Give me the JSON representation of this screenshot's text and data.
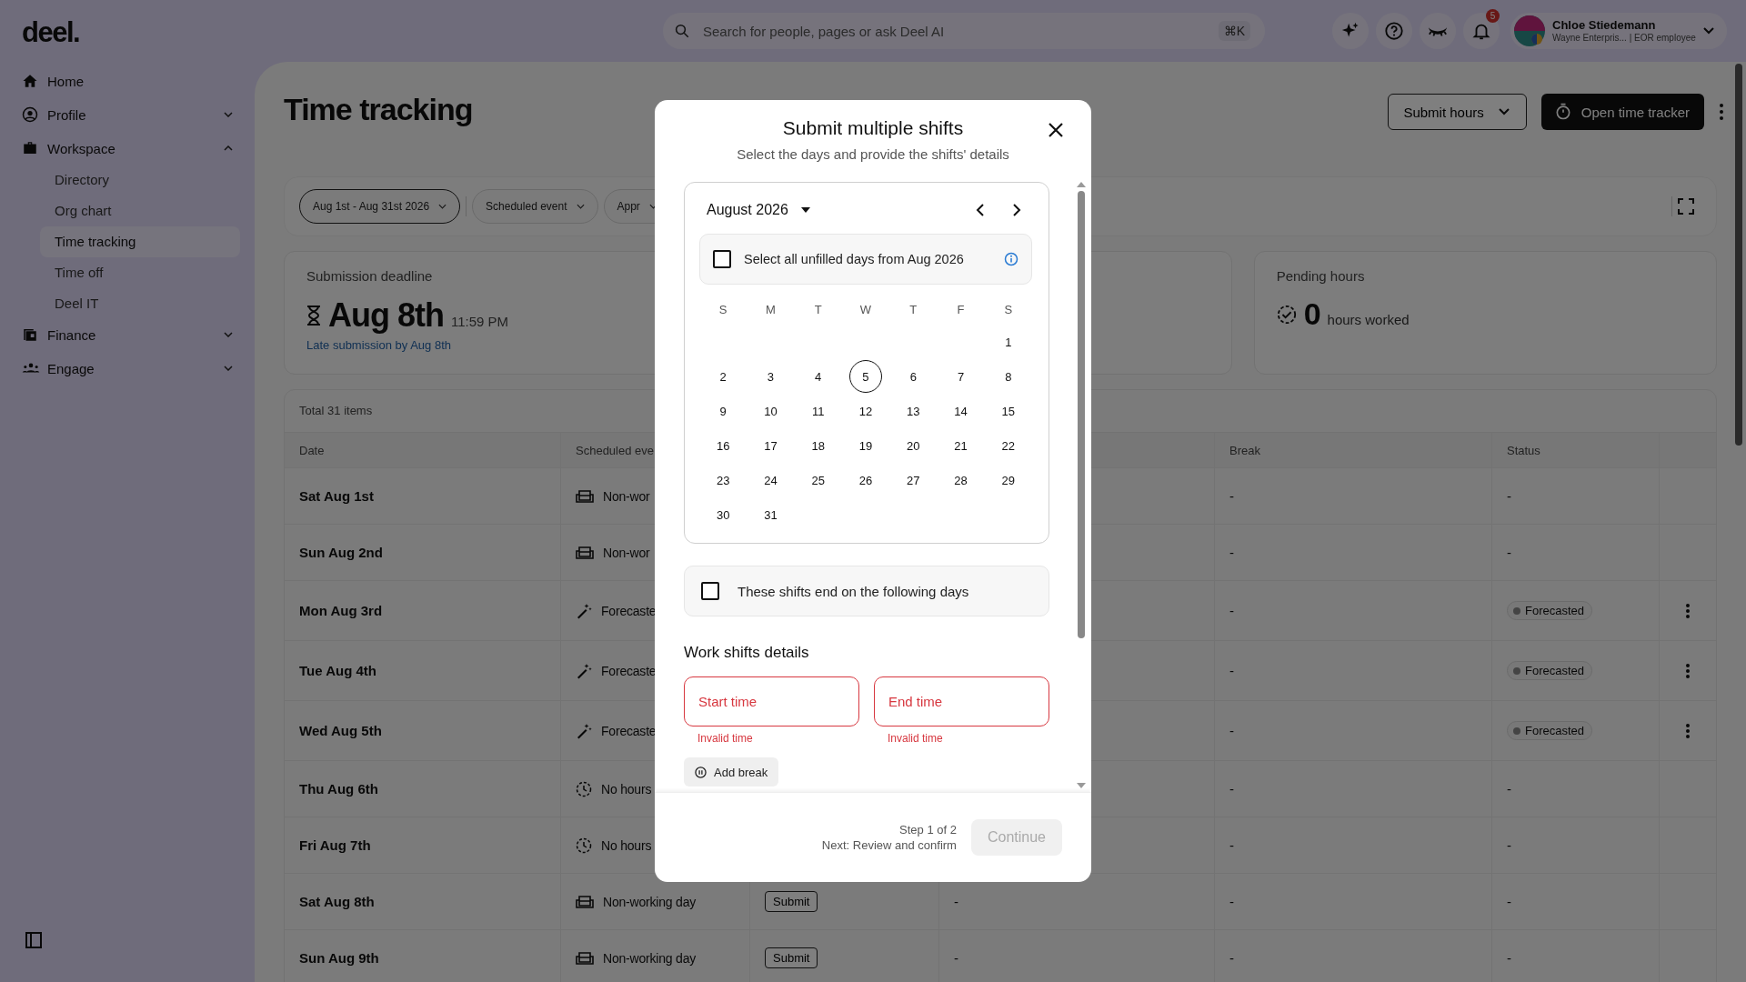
{
  "logo": "deel.",
  "search": {
    "placeholder": "Search for people, pages or ask Deel AI",
    "shortcut": "⌘K"
  },
  "notifications": {
    "count": "5"
  },
  "profile": {
    "name": "Chloe Stiedemann",
    "subtitle": "Wayne Enterpris... | EOR employee"
  },
  "sidebar": {
    "items": [
      {
        "label": "Home"
      },
      {
        "label": "Profile",
        "expanded": false
      },
      {
        "label": "Workspace",
        "expanded": true,
        "children": [
          {
            "label": "Directory",
            "selected": false
          },
          {
            "label": "Org chart",
            "selected": false
          },
          {
            "label": "Time tracking",
            "selected": true
          },
          {
            "label": "Time off",
            "selected": false
          },
          {
            "label": "Deel IT",
            "selected": false
          }
        ]
      },
      {
        "label": "Finance",
        "expanded": false
      },
      {
        "label": "Engage",
        "expanded": false
      }
    ]
  },
  "page": {
    "title": "Time tracking",
    "submit_button": "Submit hours",
    "tracker_button": "Open time tracker"
  },
  "filters": [
    {
      "label": "Aug 1st - Aug 31st 2026",
      "selected": true
    },
    {
      "label": "Scheduled event",
      "selected": false
    },
    {
      "label": "Appr",
      "selected": false
    }
  ],
  "deadline_card": {
    "title": "Submission deadline",
    "date": "Aug 8th",
    "time": "11:59 PM",
    "link": "Late submission by Aug 8th"
  },
  "pending_card": {
    "title": "Pending hours",
    "value": "0",
    "unit": "hours worked"
  },
  "table": {
    "total": "Total 31 items",
    "columns": [
      "Date",
      "Scheduled eve",
      "Break",
      "Status"
    ],
    "rows": [
      {
        "date": "Sat Aug 1st",
        "event": {
          "kind": "non_working",
          "text": "Non-wor"
        },
        "break": "-",
        "status": {
          "kind": "plain",
          "text": "-"
        },
        "menu": false
      },
      {
        "date": "Sun Aug 2nd",
        "event": {
          "kind": "non_working",
          "text": "Non-wor"
        },
        "break": "-",
        "status": {
          "kind": "plain",
          "text": "-"
        },
        "menu": false
      },
      {
        "date": "Mon Aug 3rd",
        "event": {
          "kind": "forecast",
          "text": "Forecaste"
        },
        "break": "-",
        "status": {
          "kind": "badge",
          "text": "Forecasted"
        },
        "menu": true
      },
      {
        "date": "Tue Aug 4th",
        "event": {
          "kind": "forecast",
          "text": "Forecaste"
        },
        "break": "-",
        "status": {
          "kind": "badge",
          "text": "Forecasted"
        },
        "menu": true
      },
      {
        "date": "Wed Aug 5th",
        "event": {
          "kind": "forecast",
          "text": "Forecaste"
        },
        "break": "-",
        "status": {
          "kind": "badge",
          "text": "Forecasted"
        },
        "menu": true
      },
      {
        "date": "Thu Aug 6th",
        "event": {
          "kind": "no_hours",
          "text": "No hours"
        },
        "break": "-",
        "status": {
          "kind": "plain",
          "text": "-"
        },
        "menu": false
      },
      {
        "date": "Fri Aug 7th",
        "event": {
          "kind": "no_hours",
          "text": "No hours"
        },
        "break": "-",
        "status": {
          "kind": "plain",
          "text": "-"
        },
        "menu": false
      },
      {
        "date": "Sat Aug 8th",
        "event": {
          "kind": "non_working",
          "text": "Non-working day"
        },
        "action": "Submit",
        "column_4": "-",
        "break": "-",
        "status": {
          "kind": "plain",
          "text": "-"
        },
        "menu": false
      },
      {
        "date": "Sun Aug 9th",
        "event": {
          "kind": "non_working",
          "text": "Non-working day"
        },
        "action": "Submit",
        "column_4": "-",
        "break": "-",
        "status": {
          "kind": "plain",
          "text": "-"
        },
        "menu": false
      }
    ]
  },
  "dialog": {
    "title": "Submit multiple shifts",
    "subtitle": "Select the days and provide the shifts' details",
    "calendar": {
      "month": "August 2026",
      "select_all": {
        "label": "Select all unfilled days from Aug 2026",
        "checked": false
      },
      "weekdays": [
        "S",
        "M",
        "T",
        "W",
        "T",
        "F",
        "S"
      ],
      "weeks": [
        [
          {
            "day": "1",
            "today": false
          }
        ],
        [
          {
            "day": "2",
            "today": false
          },
          {
            "day": "3",
            "today": false
          },
          {
            "day": "4",
            "today": false
          },
          {
            "day": "5",
            "today": true
          },
          {
            "day": "6",
            "today": false
          },
          {
            "day": "7",
            "today": false
          },
          {
            "day": "8",
            "today": false
          }
        ],
        [
          {
            "day": "9",
            "today": false
          },
          {
            "day": "10",
            "today": false
          },
          {
            "day": "11",
            "today": false
          },
          {
            "day": "12",
            "today": false
          },
          {
            "day": "13",
            "today": false
          },
          {
            "day": "14",
            "today": false
          },
          {
            "day": "15",
            "today": false
          }
        ],
        [
          {
            "day": "16",
            "today": false
          },
          {
            "day": "17",
            "today": false
          },
          {
            "day": "18",
            "today": false
          },
          {
            "day": "19",
            "today": false
          },
          {
            "day": "20",
            "today": false
          },
          {
            "day": "21",
            "today": false
          },
          {
            "day": "22",
            "today": false
          }
        ],
        [
          {
            "day": "23",
            "today": false
          },
          {
            "day": "24",
            "today": false
          },
          {
            "day": "25",
            "today": false
          },
          {
            "day": "26",
            "today": false
          },
          {
            "day": "27",
            "today": false
          },
          {
            "day": "28",
            "today": false
          },
          {
            "day": "29",
            "today": false
          }
        ],
        [
          {
            "day": "30",
            "today": false
          },
          {
            "day": "31",
            "today": false
          }
        ]
      ]
    },
    "end_days": {
      "label": "These shifts end on the following days",
      "checked": false
    },
    "section_title": "Work shifts details",
    "fields": [
      {
        "placeholder": "Start time",
        "invalid": true,
        "error": "Invalid time"
      },
      {
        "placeholder": "End time",
        "invalid": true,
        "error": "Invalid time"
      }
    ],
    "add_break": "Add break",
    "step": "Step 1 of 2",
    "next": "Next: Review and confirm",
    "continue": {
      "label": "Continue",
      "disabled": true
    }
  }
}
